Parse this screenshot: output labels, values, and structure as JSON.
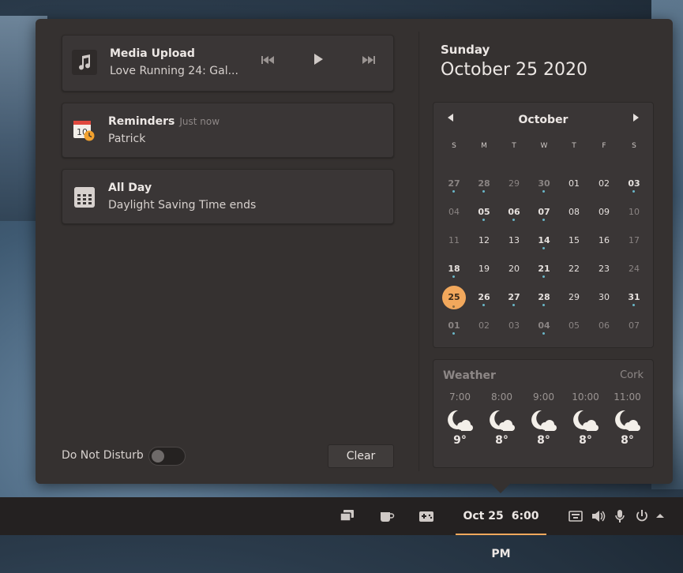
{
  "notifications": {
    "media": {
      "app": "Media Upload",
      "track": "Love Running 24:  Gal...",
      "prev_icon": "skip-back-icon",
      "play_icon": "play-icon",
      "next_icon": "skip-forward-icon"
    },
    "reminder": {
      "app": "Reminders",
      "time": "Just now",
      "body": "Patrick"
    },
    "allday": {
      "app": "All Day",
      "body": "Daylight Saving Time ends"
    }
  },
  "footer": {
    "dnd_label": "Do Not Disturb",
    "dnd_on": false,
    "clear_label": "Clear"
  },
  "date_header": {
    "day": "Sunday",
    "full": "October 25 2020"
  },
  "calendar": {
    "month": "October",
    "weekdays": [
      "S",
      "M",
      "T",
      "W",
      "T",
      "F",
      "S"
    ],
    "weeks": [
      [
        {
          "d": "27",
          "o": 1,
          "e": 1
        },
        {
          "d": "28",
          "o": 1,
          "e": 1
        },
        {
          "d": "29",
          "o": 1
        },
        {
          "d": "30",
          "o": 1,
          "e": 1
        },
        {
          "d": "01"
        },
        {
          "d": "02"
        },
        {
          "d": "03",
          "e": 1
        }
      ],
      [
        {
          "d": "04",
          "w": 1
        },
        {
          "d": "05",
          "e": 1
        },
        {
          "d": "06",
          "e": 1
        },
        {
          "d": "07",
          "e": 1
        },
        {
          "d": "08"
        },
        {
          "d": "09"
        },
        {
          "d": "10",
          "w": 1
        }
      ],
      [
        {
          "d": "11",
          "w": 1
        },
        {
          "d": "12"
        },
        {
          "d": "13"
        },
        {
          "d": "14",
          "e": 1
        },
        {
          "d": "15"
        },
        {
          "d": "16"
        },
        {
          "d": "17",
          "w": 1
        }
      ],
      [
        {
          "d": "18",
          "e": 1
        },
        {
          "d": "19"
        },
        {
          "d": "20"
        },
        {
          "d": "21",
          "e": 1
        },
        {
          "d": "22"
        },
        {
          "d": "23"
        },
        {
          "d": "24",
          "w": 1
        }
      ],
      [
        {
          "d": "25",
          "t": 1,
          "e": 1
        },
        {
          "d": "26",
          "e": 1
        },
        {
          "d": "27",
          "e": 1
        },
        {
          "d": "28",
          "e": 1
        },
        {
          "d": "29"
        },
        {
          "d": "30"
        },
        {
          "d": "31",
          "e": 1
        }
      ],
      [
        {
          "d": "01",
          "o": 1,
          "e": 1
        },
        {
          "d": "02",
          "o": 1
        },
        {
          "d": "03",
          "o": 1
        },
        {
          "d": "04",
          "o": 1,
          "e": 1
        },
        {
          "d": "05",
          "o": 1
        },
        {
          "d": "06",
          "o": 1
        },
        {
          "d": "07",
          "o": 1
        }
      ]
    ]
  },
  "weather": {
    "title": "Weather",
    "location": "Cork",
    "hours": [
      {
        "time": "7:00",
        "temp": "9°",
        "icon": "night-cloudy-icon"
      },
      {
        "time": "8:00",
        "temp": "8°",
        "icon": "night-cloudy-icon"
      },
      {
        "time": "9:00",
        "temp": "8°",
        "icon": "night-cloudy-icon"
      },
      {
        "time": "10:00",
        "temp": "8°",
        "icon": "night-cloudy-icon"
      },
      {
        "time": "11:00",
        "temp": "8°",
        "icon": "night-cloudy-icon"
      }
    ]
  },
  "panel": {
    "date": "Oct 25",
    "time": "6:00 PM",
    "left_icons": [
      "workspaces-icon",
      "caffeine-icon",
      "gamepad-icon"
    ],
    "right_icons": [
      "keyboard-icon",
      "volume-icon",
      "microphone-icon",
      "power-icon",
      "arrow-up-icon"
    ]
  },
  "colors": {
    "accent": "#f2a85c",
    "event_dot": "#69b7c8",
    "surface": "#353130"
  }
}
